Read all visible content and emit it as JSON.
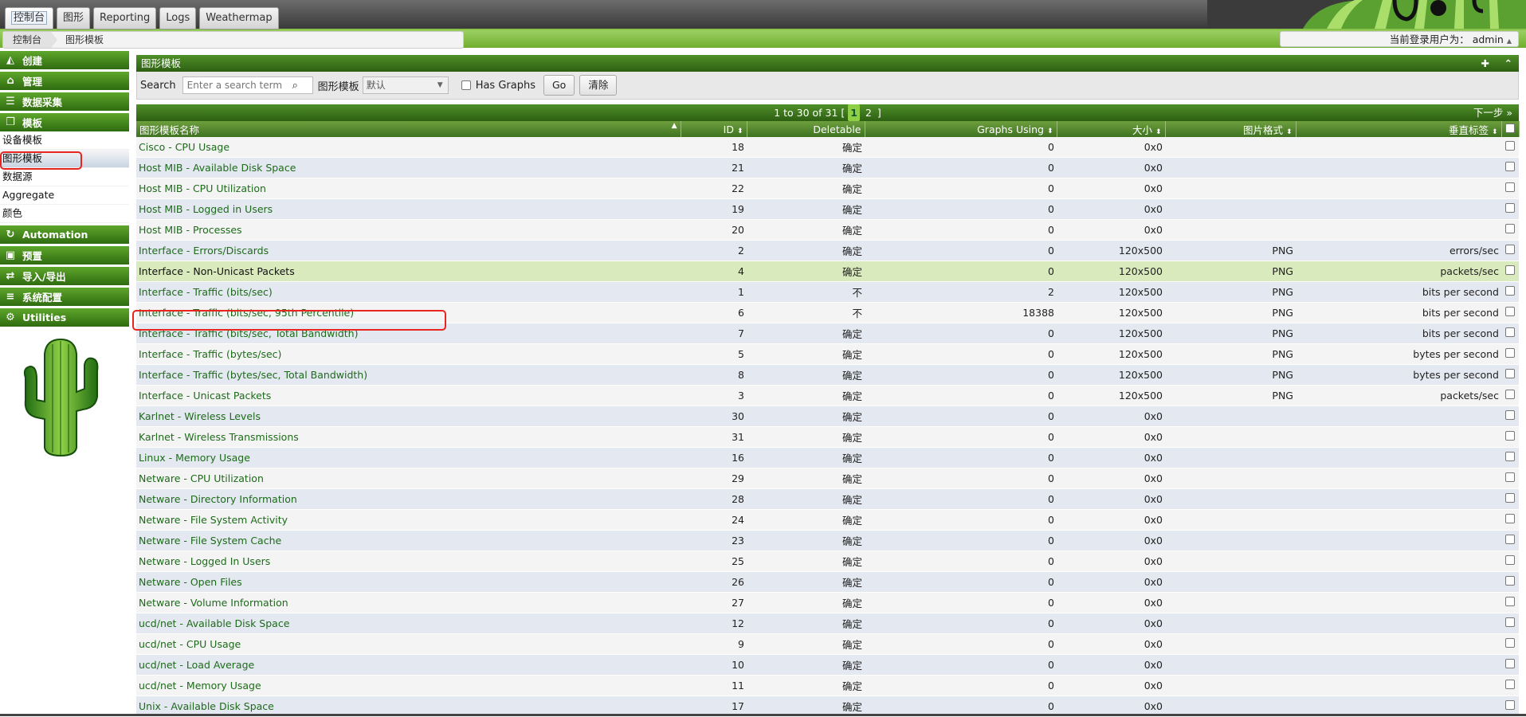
{
  "top_tabs": [
    "控制台",
    "图形",
    "Reporting",
    "Logs",
    "Weathermap"
  ],
  "breadcrumb": [
    "控制台",
    "图形模板"
  ],
  "user": {
    "label": "当前登录用户为：",
    "name": "admin",
    "caret": "▲"
  },
  "sidebar": {
    "sections": [
      {
        "label": "创建",
        "icon": "chart-icon"
      },
      {
        "label": "管理",
        "icon": "home-icon"
      },
      {
        "label": "数据采集",
        "icon": "database-icon"
      },
      {
        "label": "模板",
        "icon": "template-icon"
      }
    ],
    "template_items": [
      "设备模板",
      "图形模板",
      "数据源",
      "Aggregate",
      "颜色"
    ],
    "sections_after": [
      {
        "label": "Automation",
        "icon": "automation-icon"
      },
      {
        "label": "预置",
        "icon": "preset-icon"
      },
      {
        "label": "导入/导出",
        "icon": "import-export-icon"
      },
      {
        "label": "系统配置",
        "icon": "settings-icon"
      },
      {
        "label": "Utilities",
        "icon": "utilities-icon"
      }
    ]
  },
  "panel": {
    "title": "图形模板",
    "add_symbol": "✚",
    "collapse_symbol": "⌃"
  },
  "filter": {
    "search_label": "Search",
    "search_placeholder": "Enter a search term",
    "template_label": "图形模板",
    "template_value": "默认",
    "has_graphs_label": "Has Graphs",
    "go_label": "Go",
    "clear_label": "清除"
  },
  "pagination": {
    "summary": "1 to 30 of 31 [",
    "pages": [
      "1",
      "2"
    ],
    "close": "]",
    "next": "下一步 »"
  },
  "table": {
    "columns": [
      "图形模板名称",
      "ID",
      "Deletable",
      "Graphs Using",
      "大小",
      "图片格式",
      "垂直标签"
    ],
    "rows": [
      [
        "Cisco - CPU Usage",
        "18",
        "确定",
        "0",
        "0x0",
        "",
        ""
      ],
      [
        "Host MIB - Available Disk Space",
        "21",
        "确定",
        "0",
        "0x0",
        "",
        ""
      ],
      [
        "Host MIB - CPU Utilization",
        "22",
        "确定",
        "0",
        "0x0",
        "",
        ""
      ],
      [
        "Host MIB - Logged in Users",
        "19",
        "确定",
        "0",
        "0x0",
        "",
        ""
      ],
      [
        "Host MIB - Processes",
        "20",
        "确定",
        "0",
        "0x0",
        "",
        ""
      ],
      [
        "Interface - Errors/Discards",
        "2",
        "确定",
        "0",
        "120x500",
        "PNG",
        "errors/sec"
      ],
      [
        "Interface - Non-Unicast Packets",
        "4",
        "确定",
        "0",
        "120x500",
        "PNG",
        "packets/sec"
      ],
      [
        "Interface - Traffic (bits/sec)",
        "1",
        "不",
        "2",
        "120x500",
        "PNG",
        "bits per second"
      ],
      [
        "Interface - Traffic (bits/sec, 95th Percentile)",
        "6",
        "不",
        "18388",
        "120x500",
        "PNG",
        "bits per second"
      ],
      [
        "Interface - Traffic (bits/sec, Total Bandwidth)",
        "7",
        "确定",
        "0",
        "120x500",
        "PNG",
        "bits per second"
      ],
      [
        "Interface - Traffic (bytes/sec)",
        "5",
        "确定",
        "0",
        "120x500",
        "PNG",
        "bytes per second"
      ],
      [
        "Interface - Traffic (bytes/sec, Total Bandwidth)",
        "8",
        "确定",
        "0",
        "120x500",
        "PNG",
        "bytes per second"
      ],
      [
        "Interface - Unicast Packets",
        "3",
        "确定",
        "0",
        "120x500",
        "PNG",
        "packets/sec"
      ],
      [
        "Karlnet - Wireless Levels",
        "30",
        "确定",
        "0",
        "0x0",
        "",
        ""
      ],
      [
        "Karlnet - Wireless Transmissions",
        "31",
        "确定",
        "0",
        "0x0",
        "",
        ""
      ],
      [
        "Linux - Memory Usage",
        "16",
        "确定",
        "0",
        "0x0",
        "",
        ""
      ],
      [
        "Netware - CPU Utilization",
        "29",
        "确定",
        "0",
        "0x0",
        "",
        ""
      ],
      [
        "Netware - Directory Information",
        "28",
        "确定",
        "0",
        "0x0",
        "",
        ""
      ],
      [
        "Netware - File System Activity",
        "24",
        "确定",
        "0",
        "0x0",
        "",
        ""
      ],
      [
        "Netware - File System Cache",
        "23",
        "确定",
        "0",
        "0x0",
        "",
        ""
      ],
      [
        "Netware - Logged In Users",
        "25",
        "确定",
        "0",
        "0x0",
        "",
        ""
      ],
      [
        "Netware - Open Files",
        "26",
        "确定",
        "0",
        "0x0",
        "",
        ""
      ],
      [
        "Netware - Volume Information",
        "27",
        "确定",
        "0",
        "0x0",
        "",
        ""
      ],
      [
        "ucd/net - Available Disk Space",
        "12",
        "确定",
        "0",
        "0x0",
        "",
        ""
      ],
      [
        "ucd/net - CPU Usage",
        "9",
        "确定",
        "0",
        "0x0",
        "",
        ""
      ],
      [
        "ucd/net - Load Average",
        "10",
        "确定",
        "0",
        "0x0",
        "",
        ""
      ],
      [
        "ucd/net - Memory Usage",
        "11",
        "确定",
        "0",
        "0x0",
        "",
        ""
      ],
      [
        "Unix - Available Disk Space",
        "17",
        "确定",
        "0",
        "0x0",
        "",
        ""
      ]
    ],
    "hover_row": 6,
    "highlight_row": 8
  },
  "colors": {
    "accent_green": "#2d5f12",
    "link_green": "#1d6b1a",
    "highlight_red": "#e8261f"
  }
}
